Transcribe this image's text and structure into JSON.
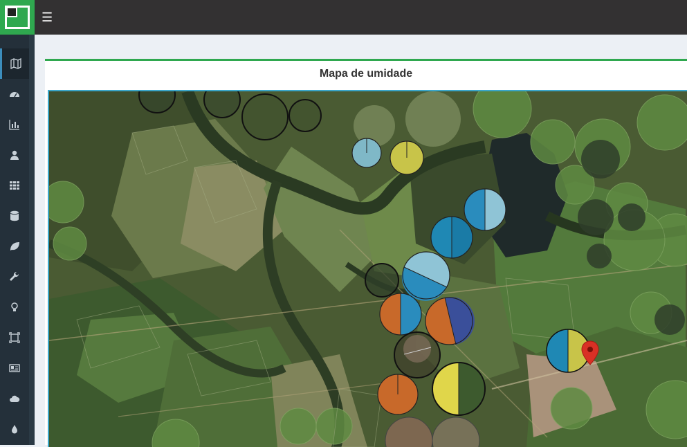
{
  "header": {
    "menu_icon": "hamburger-icon",
    "logo": "app-logo"
  },
  "sidebar": {
    "items": [
      {
        "name": "map",
        "icon": "map-icon",
        "active": true
      },
      {
        "name": "dashboard",
        "icon": "tachometer-icon"
      },
      {
        "name": "charts",
        "icon": "bar-chart-icon"
      },
      {
        "name": "user",
        "icon": "user-icon"
      },
      {
        "name": "grid",
        "icon": "grid-icon"
      },
      {
        "name": "database",
        "icon": "database-icon"
      },
      {
        "name": "leaf",
        "icon": "leaf-icon"
      },
      {
        "name": "tools",
        "icon": "wrench-icon"
      },
      {
        "name": "ideas",
        "icon": "lightbulb-icon"
      },
      {
        "name": "focus",
        "icon": "frame-icon"
      },
      {
        "name": "news",
        "icon": "newspaper-icon"
      },
      {
        "name": "cloud",
        "icon": "cloud-icon"
      },
      {
        "name": "water",
        "icon": "droplet-icon"
      }
    ]
  },
  "panel": {
    "title": "Mapa de umidade"
  },
  "map": {
    "marker_icon": "location-pin-icon",
    "colors": {
      "orange": "#c8692a",
      "blue": "#1f88b4",
      "lightblue": "#7fbfd4",
      "yellow": "#d2c94a",
      "navy": "#3a4f9a",
      "accent": "#3c8dbc",
      "brand": "#2fa84f",
      "marker": "#d93025"
    }
  }
}
